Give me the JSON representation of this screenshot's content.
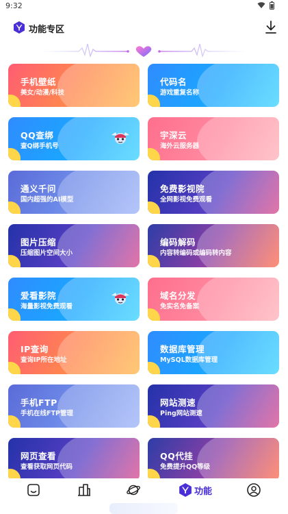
{
  "status": {
    "time": "9:32"
  },
  "header": {
    "title": "功能专区"
  },
  "cards": [
    {
      "title": "手机壁纸",
      "subtitle": "美女/动漫/科技",
      "theme": "orange",
      "mascot": false
    },
    {
      "title": "代码名",
      "subtitle": "游戏重复名称",
      "theme": "blue",
      "mascot": false
    },
    {
      "title": "QQ查绑",
      "subtitle": "查Q绑手机号",
      "theme": "blue",
      "mascot": true
    },
    {
      "title": "宇深云",
      "subtitle": "海外云服务器",
      "theme": "pink",
      "mascot": false
    },
    {
      "title": "通义千问",
      "subtitle": "国内超强的AI模型",
      "theme": "violet",
      "mascot": false
    },
    {
      "title": "免费影视院",
      "subtitle": "全网影视免费观看",
      "theme": "deep",
      "mascot": false
    },
    {
      "title": "图片压缩",
      "subtitle": "压缩图片空间大小",
      "theme": "deep",
      "mascot": false
    },
    {
      "title": "编码解码",
      "subtitle": "内容转编码或编码转内容",
      "theme": "sunset",
      "mascot": false
    },
    {
      "title": "爱看影院",
      "subtitle": "海量影视免费观看",
      "theme": "blue",
      "mascot": true
    },
    {
      "title": "域名分发",
      "subtitle": "免实名免备案",
      "theme": "pink",
      "mascot": false
    },
    {
      "title": "IP查询",
      "subtitle": "查询IP所在地址",
      "theme": "orange",
      "mascot": false
    },
    {
      "title": "数据库管理",
      "subtitle": "MySQL数据库管理",
      "theme": "blue",
      "mascot": false
    },
    {
      "title": "手机FTP",
      "subtitle": "手机在线FTP管理",
      "theme": "violet",
      "mascot": false
    },
    {
      "title": "网站测速",
      "subtitle": "Ping网站测速",
      "theme": "deep",
      "mascot": false
    },
    {
      "title": "网页查看",
      "subtitle": "查看获取网页代码",
      "theme": "deep",
      "mascot": false
    },
    {
      "title": "QQ代挂",
      "subtitle": "免费提升QQ等级",
      "theme": "sunset",
      "mascot": false
    }
  ],
  "tabbar": {
    "active_label": "功能",
    "tabs": [
      {
        "icon": "home-icon",
        "active": false
      },
      {
        "icon": "building-icon",
        "active": false
      },
      {
        "icon": "planet-icon",
        "active": false
      },
      {
        "icon": "function-icon",
        "active": true
      },
      {
        "icon": "profile-icon",
        "active": false
      }
    ]
  },
  "colors": {
    "accent": "#4b2fd6",
    "sun": "#ffd54a"
  }
}
